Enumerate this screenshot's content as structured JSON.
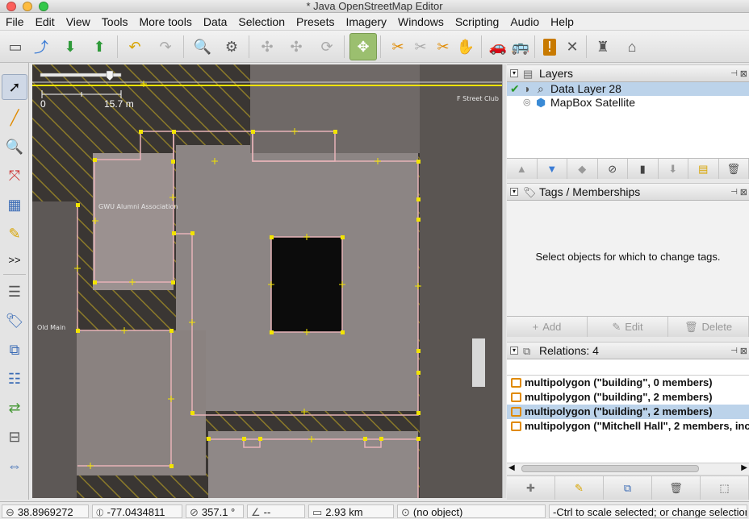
{
  "window": {
    "title": "* Java OpenStreetMap Editor"
  },
  "menu": [
    {
      "label": "File"
    },
    {
      "label": "Edit"
    },
    {
      "label": "View"
    },
    {
      "label": "Tools"
    },
    {
      "label": "More tools"
    },
    {
      "label": "Data"
    },
    {
      "label": "Selection"
    },
    {
      "label": "Presets"
    },
    {
      "label": "Imagery"
    },
    {
      "label": "Windows"
    },
    {
      "label": "Scripting"
    },
    {
      "label": "Audio"
    },
    {
      "label": "Help"
    }
  ],
  "map": {
    "scale_start": "0",
    "scale_end": "15.7 m",
    "labels": {
      "gwu": "GWU Alumni Association",
      "oldmain": "Old Main",
      "fstreet": "F Street Club"
    }
  },
  "layers": {
    "title": "Layers",
    "items": [
      {
        "name": "Data Layer 28",
        "selected": true
      },
      {
        "name": "MapBox Satellite",
        "selected": false
      }
    ]
  },
  "tags": {
    "title": "Tags / Memberships",
    "empty_message": "Select objects for which to change tags.",
    "add_label": "Add",
    "edit_label": "Edit",
    "delete_label": "Delete"
  },
  "relations": {
    "title": "Relations: 4",
    "items": [
      {
        "label": "multipolygon (\"building\", 0 members)",
        "selected": false
      },
      {
        "label": "multipolygon (\"building\", 2 members)",
        "selected": false
      },
      {
        "label": "multipolygon (\"building\", 2 members)",
        "selected": true
      },
      {
        "label": "multipolygon (\"Mitchell Hall\", 2 members, inc",
        "selected": false
      }
    ]
  },
  "status": {
    "lat": "38.8969272",
    "lon": "-77.0434811",
    "heading": "357.1 °",
    "angle": "--",
    "distance": "2.93 km",
    "object": "(no object)",
    "help": "-Ctrl to scale selected; or change selection"
  },
  "colors": {
    "selection_green": "#9bbf6f",
    "row_selected": "#bcd3ea",
    "way_pink": "#e7b3b8",
    "node_yellow": "#f2e400",
    "relation_orange": "#e08a00"
  }
}
